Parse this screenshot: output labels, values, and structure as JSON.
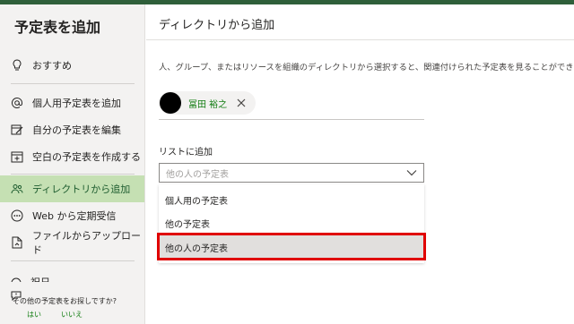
{
  "sidebar": {
    "title": "予定表を追加",
    "items": [
      {
        "label": "おすすめ",
        "icon": "lightbulb-icon"
      },
      {
        "label": "個人用予定表を追加",
        "icon": "at-icon"
      },
      {
        "label": "自分の予定表を編集",
        "icon": "edit-calendar-icon"
      },
      {
        "label": "空白の予定表を作成する",
        "icon": "add-calendar-icon"
      },
      {
        "label": "ディレクトリから追加",
        "icon": "people-icon"
      },
      {
        "label": "Web から定期受信",
        "icon": "more-circle-icon"
      },
      {
        "label": "ファイルからアップロード",
        "icon": "file-upload-icon"
      },
      {
        "label": "祝日",
        "icon": "globe-icon"
      }
    ],
    "selected_index": 4,
    "footer": {
      "question": "その他の予定表をお探しですか?",
      "yes": "はい",
      "no": "いいえ"
    }
  },
  "main": {
    "title": "ディレクトリから追加",
    "description": "人、グループ、またはリソースを組織のディレクトリから選択すると、関連付けられた予定表を見ることができます。",
    "person": {
      "name": "冨田 裕之"
    },
    "list_label": "リストに追加",
    "dropdown": {
      "value": "他の人の予定表",
      "options": [
        "個人用の予定表",
        "他の予定表",
        "他の人の予定表"
      ],
      "highlighted_index": 2
    }
  },
  "colors": {
    "accent": "#107c10",
    "selected_bg": "#c5e0b3",
    "highlight_border": "#e00000"
  }
}
